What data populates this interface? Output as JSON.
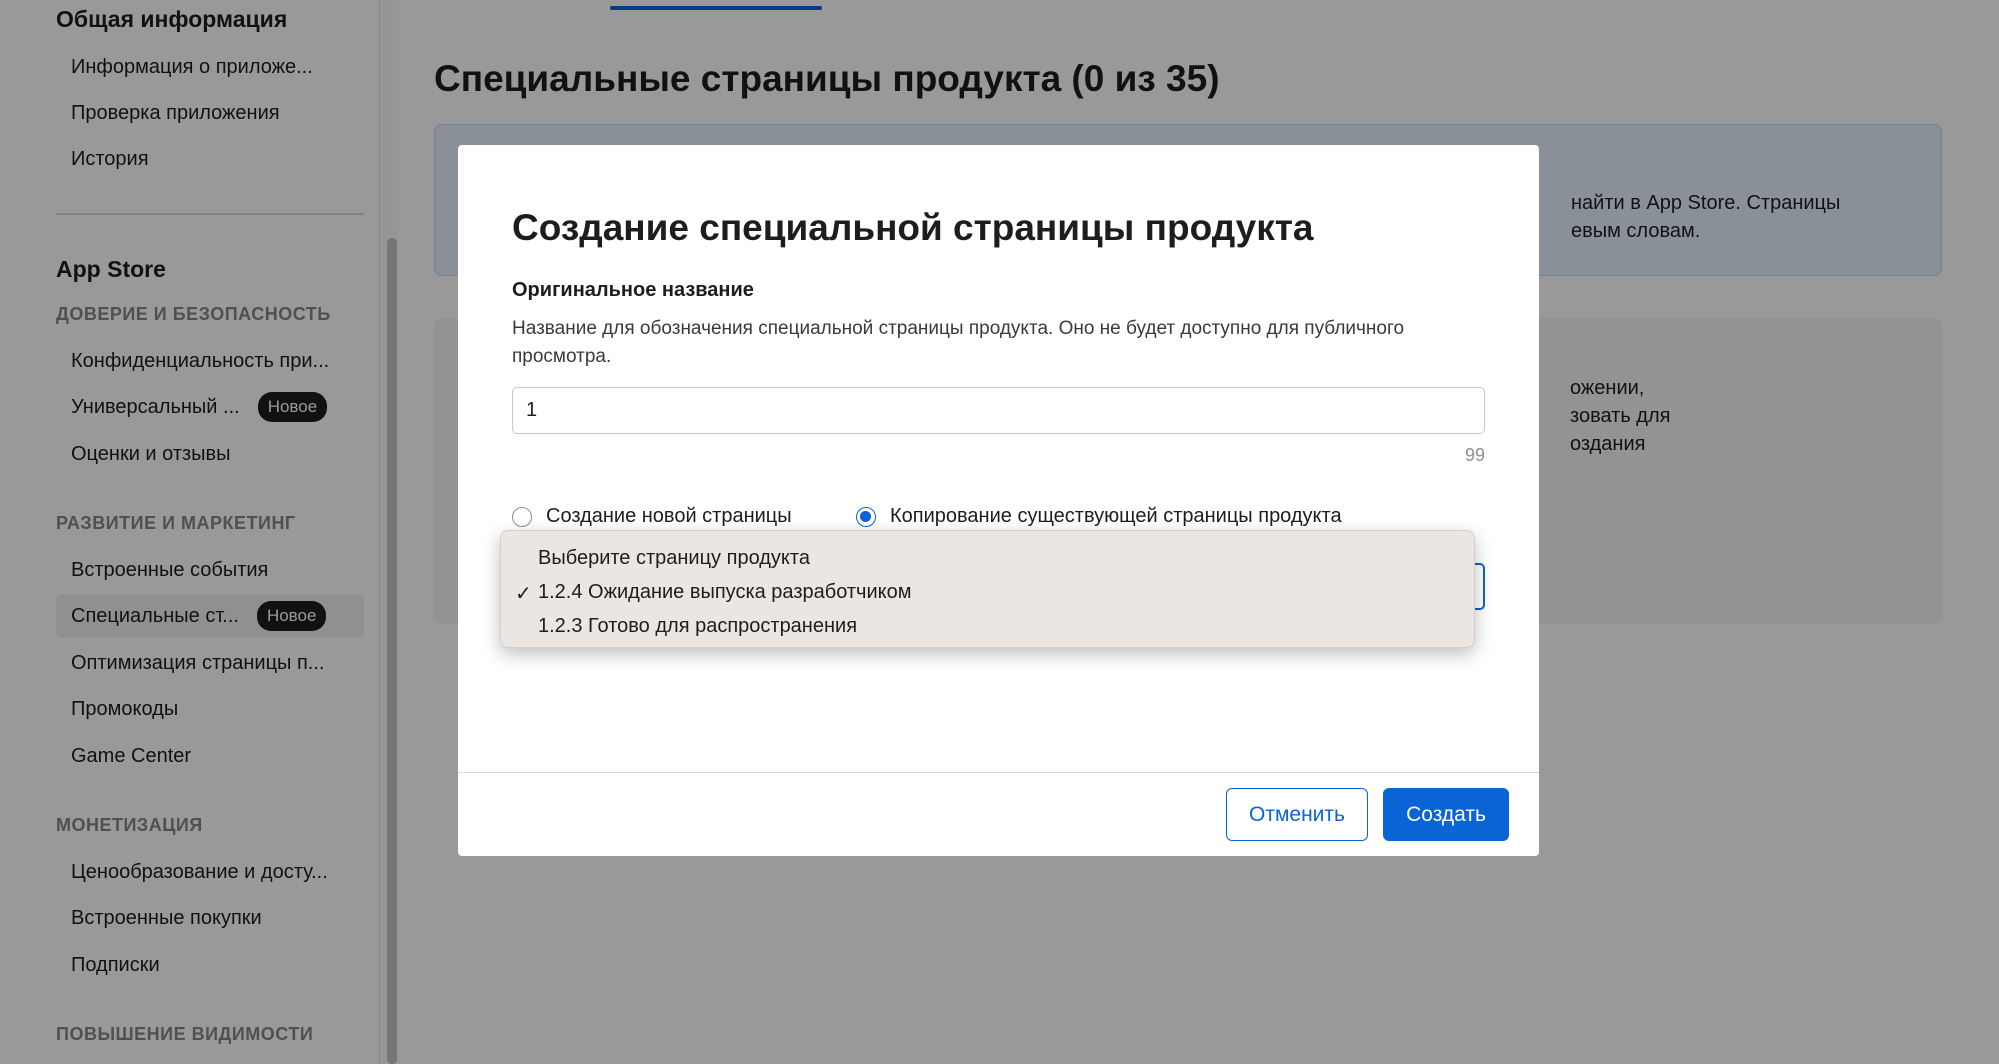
{
  "sidebar": {
    "general_title": "Общая информация",
    "general_items": [
      {
        "label": "Информация о приложе..."
      },
      {
        "label": "Проверка приложения"
      },
      {
        "label": "История"
      }
    ],
    "appstore_title": "App Store",
    "section_trust": "ДОВЕРИЕ И БЕЗОПАСНОСТЬ",
    "trust_items": [
      {
        "label": "Конфиденциальность при..."
      },
      {
        "label": "Универсальный ...",
        "badge": "Новое"
      },
      {
        "label": "Оценки и отзывы"
      }
    ],
    "section_growth": "РАЗВИТИЕ И МАРКЕТИНГ",
    "growth_items": [
      {
        "label": "Встроенные события"
      },
      {
        "label": "Специальные ст...",
        "badge": "Новое",
        "active": true
      },
      {
        "label": "Оптимизация страницы п..."
      },
      {
        "label": "Промокоды"
      },
      {
        "label": "Game Center"
      }
    ],
    "section_monetization": "МОНЕТИЗАЦИЯ",
    "monetization_items": [
      {
        "label": "Ценообразование и досту..."
      },
      {
        "label": "Встроенные покупки"
      },
      {
        "label": "Подписки"
      }
    ],
    "section_visibility": "ПОВЫШЕНИЕ ВИДИМОСТИ"
  },
  "main": {
    "page_title": "Специальные страницы продукта (0 из 35)",
    "info_box_lines": [
      "найти в App Store. Страницы",
      "евым словам."
    ],
    "card_lines": [
      "ожении,",
      "зовать для",
      "оздания"
    ]
  },
  "modal": {
    "title": "Создание специальной страницы продукта",
    "field_label": "Оригинальное название",
    "field_description": "Название для обозначения специальной страницы продукта. Оно не будет доступно для публичного просмотра.",
    "name_value": "1",
    "char_count": "99",
    "radio_new": "Создание новой страницы",
    "radio_copy": "Копирование существующей страницы продукта",
    "cancel_label": "Отменить",
    "create_label": "Создать"
  },
  "dropdown": {
    "items": [
      {
        "label": "Выберите страницу продукта",
        "checked": false
      },
      {
        "label": "1.2.4 Ожидание выпуска разработчиком",
        "checked": true
      },
      {
        "label": "1.2.3 Готово для распространения",
        "checked": false
      }
    ],
    "check_glyph": "✓"
  },
  "colors": {
    "accent": "#0a64d6",
    "badge_bg": "#1d1d1f",
    "overlay": "rgba(0,0,0,0.40)"
  }
}
